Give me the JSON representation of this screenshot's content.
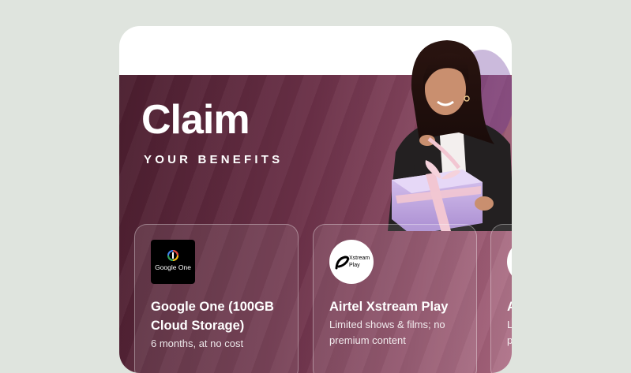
{
  "promo": {
    "title": "Claim",
    "subtitle": "YOUR BENEFITS"
  },
  "offers": [
    {
      "logo_text": "Google One",
      "title": "Google One (100GB Cloud Storage)",
      "description": "6 months, at no cost"
    },
    {
      "logo_text_line1": "Xstream",
      "logo_text_line2": "Play",
      "title": "Airtel Xstream Play",
      "description": "Limited shows & films; no premium content"
    },
    {
      "title": "A",
      "description": "L p"
    }
  ],
  "colors": {
    "page_background": "#dfe4de",
    "hero_gradient_start": "#4a1d2e",
    "hero_gradient_end": "#a9677f",
    "gift_box": "#c9b2e6",
    "ribbon": "#f2c6d2"
  }
}
